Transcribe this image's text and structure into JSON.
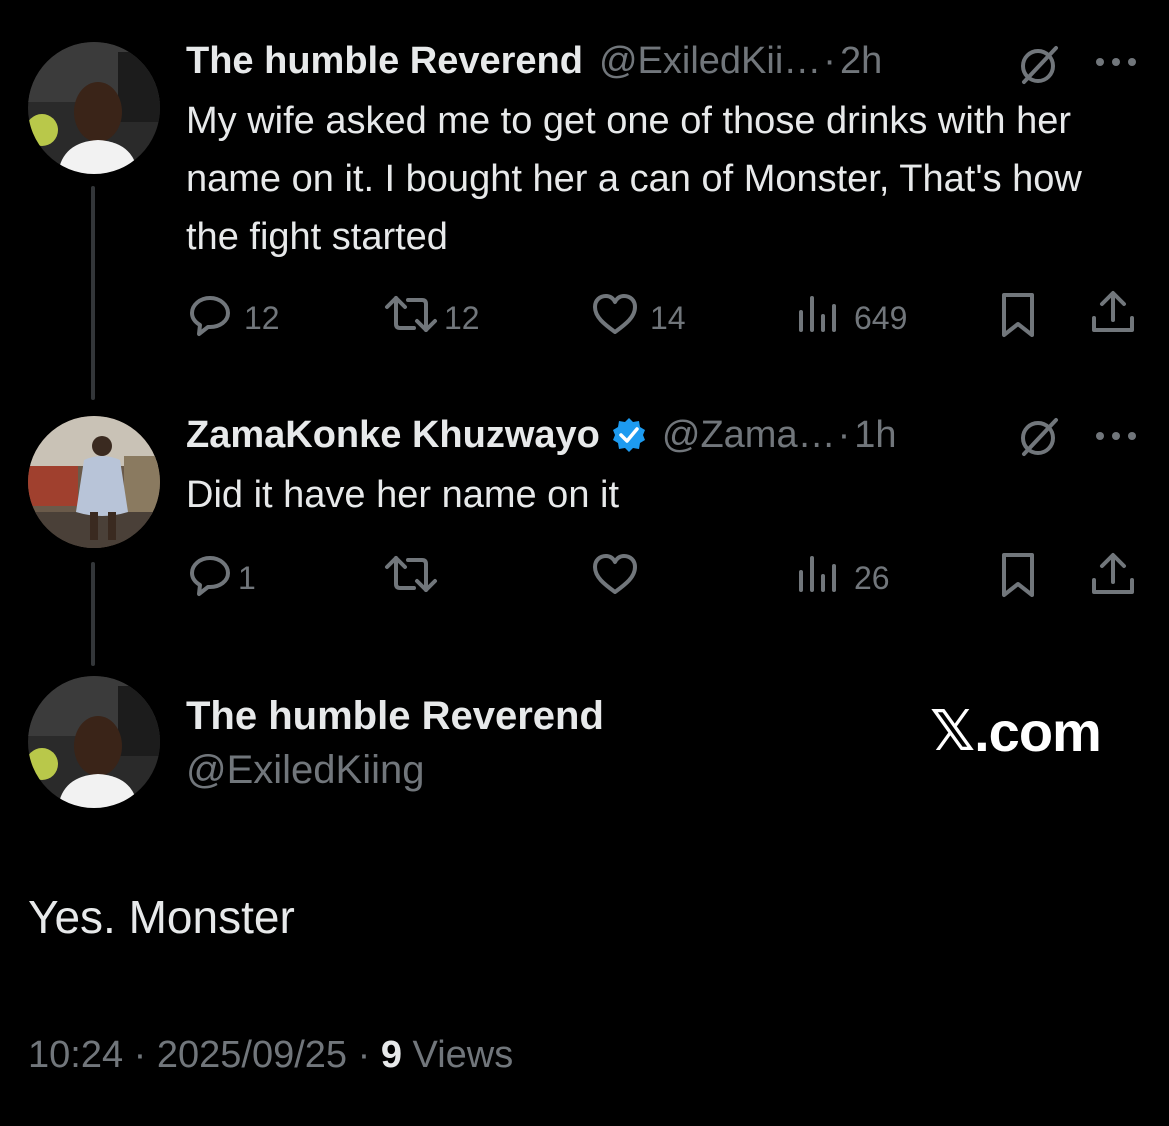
{
  "tweet1": {
    "name": "The humble Reverend",
    "handle": "@ExiledKii…",
    "sep": "·",
    "time": "2h",
    "text": "My wife asked me to get one of those drinks with her name on it. I bought her a can of Monster, That's how the fight started",
    "replies": "12",
    "reposts": "12",
    "likes": "14",
    "views": "649"
  },
  "tweet2": {
    "name": "ZamaKonke Khuzwayo",
    "handle": "@Zama…",
    "sep": "·",
    "time": "1h",
    "text": "Did it have her name on it",
    "replies": "1",
    "reposts": "",
    "likes": "",
    "views": "26"
  },
  "main": {
    "name": "The humble Reverend",
    "handle": "@ExiledKiing",
    "text": "Yes. Monster",
    "time": "10:24",
    "date": "2025/09/25",
    "sep": "·",
    "views_count": "9",
    "views_label": "Views"
  },
  "watermark": {
    "logo": "𝕏",
    "text": ".com"
  },
  "colors": {
    "background": "#000000",
    "text": "#e7e9ea",
    "muted": "#71767b",
    "verified": "#1d9bf0",
    "thread_line": "#333639"
  },
  "icons": {
    "reply": "reply-icon",
    "repost": "repost-icon",
    "like": "like-icon",
    "views": "views-icon",
    "bookmark": "bookmark-icon",
    "share": "share-icon",
    "grok": "grok-icon",
    "more": "more-icon",
    "verified": "verified-badge-icon"
  }
}
